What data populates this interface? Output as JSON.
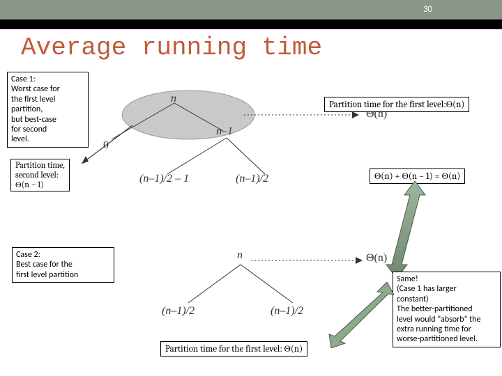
{
  "slide_number": "30",
  "title": "Average running time",
  "case1": {
    "text": "Case 1:\nWorst case for\nthe first level\npartition,\nbut best-case\nfor second\nlevel."
  },
  "case2": {
    "text": "Case 2:\nBest case for the\nfirst level partition"
  },
  "partition_second": "Partition time,\nsecond level:\nΘ(n − 1)",
  "partition_first_top": "Partition time for the first level:Θ(n)",
  "theta_eq": "Θ(n) + Θ(n − 1) = Θ(n)",
  "partition_first_bottom": "Partition time for the first level: Θ(n)",
  "same_note": "Same!\n(Case 1 has larger\nconstant)\nThe better-partitioned\nlevel would \"absorb\" the\nextra running time for\nworse-partitioned level.",
  "labels": {
    "n1": "n",
    "zero": "0",
    "nm1": "n–1",
    "split_a": "(n–1)/2 – 1",
    "split_b": "(n–1)/2",
    "theta_n_top": "Θ(n)",
    "n2": "n",
    "split2_a": "(n–1)/2",
    "split2_b": "(n–1)/2",
    "theta_n_bottom": "Θ(n)"
  }
}
